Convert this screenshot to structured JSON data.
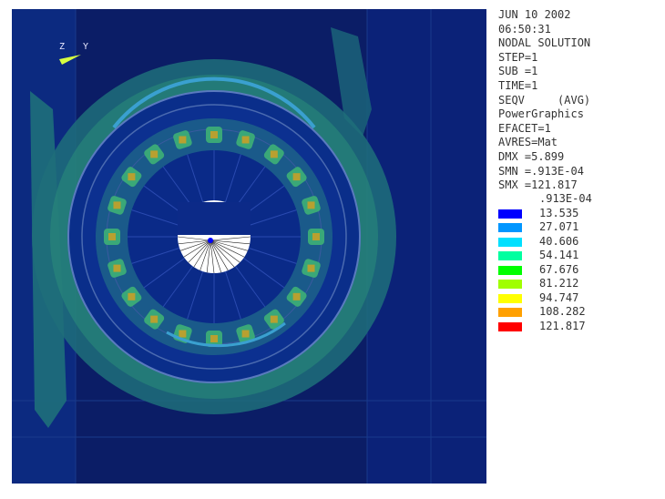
{
  "header": {
    "date": "JUN 10 2002",
    "time": "06:50:31",
    "solution": "NODAL SOLUTION",
    "step": "STEP=1",
    "sub": "SUB =1",
    "time_val": "TIME=1",
    "result": "SEQV     (AVG)",
    "graphics": "PowerGraphics",
    "efacet": "EFACET=1",
    "avres": "AVRES=Mat",
    "dmx": "DMX =5.899",
    "smn": "SMN =.913E-04",
    "smx": "SMX =121.817"
  },
  "triad": {
    "z": "Z",
    "y": "Y"
  },
  "legend": {
    "min": ".913E-04",
    "entries": [
      {
        "value": "13.535",
        "color": "#0000ff"
      },
      {
        "value": "27.071",
        "color": "#0096ff"
      },
      {
        "value": "40.606",
        "color": "#00e0ff"
      },
      {
        "value": "54.141",
        "color": "#00ffa0"
      },
      {
        "value": "67.676",
        "color": "#00ff00"
      },
      {
        "value": "81.212",
        "color": "#a0ff00"
      },
      {
        "value": "94.747",
        "color": "#ffff00"
      },
      {
        "value": "108.282",
        "color": "#ffa000"
      },
      {
        "value": "121.817",
        "color": "#ff0000"
      }
    ]
  },
  "colors": {
    "background": "#0a1a5c",
    "low_stress": "#0a2e8a",
    "mid_stress": "#1e6f7a",
    "teal_stress": "#2a9a7a"
  }
}
